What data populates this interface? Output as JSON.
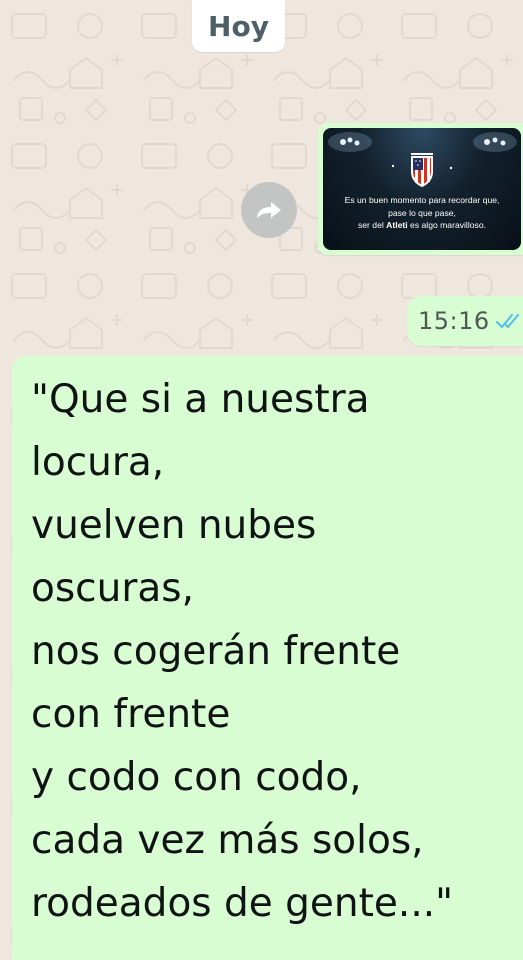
{
  "chat": {
    "date_chip": "Hoy",
    "image_message": {
      "caption_lines": [
        "Es un buen momento para recordar que,",
        "pase lo que pase,",
        "ser del",
        "Atleti",
        "es algo maravilloso."
      ]
    },
    "timestamp": "15:16",
    "quote_lines": [
      "\"Que si a nuestra",
      "locura,",
      "vuelven nubes",
      "oscuras,",
      "nos cogerán frente",
      "con frente",
      "y codo con codo,",
      "cada vez más solos,",
      "rodeados de gente...\""
    ]
  },
  "icons": {
    "forward": "forward-icon",
    "read_receipt": "double-check-icon",
    "crest": "crest-icon"
  },
  "colors": {
    "chat_background": "#efe7de",
    "outgoing_bubble": "#d9fdd3",
    "date_chip": "#ffffff",
    "read_receipt": "#53bdeb",
    "forward_button": "#c3c4c4"
  }
}
